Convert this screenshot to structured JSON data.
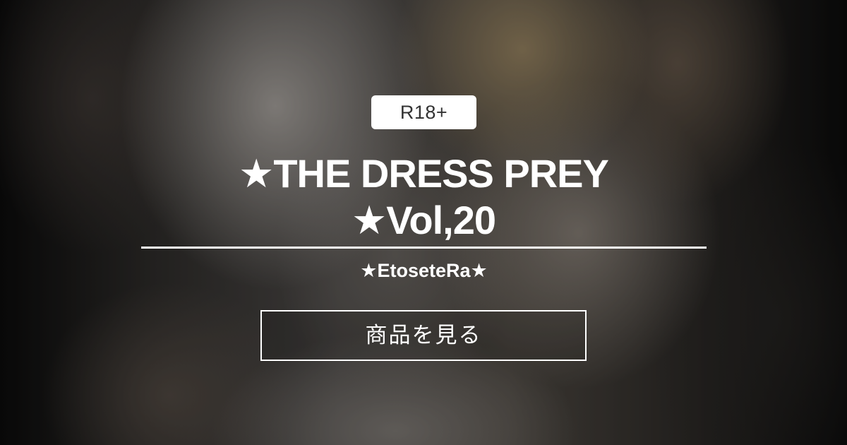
{
  "badge": {
    "rating": "R18+"
  },
  "product": {
    "title_line1": "★THE DRESS PREY",
    "title_line2": "★Vol,20",
    "creator": "★EtoseteRa★"
  },
  "actions": {
    "view_product_label": "商品を見る"
  },
  "colors": {
    "badge_background": "#ffffff",
    "badge_text": "#333333",
    "text": "#ffffff",
    "button_border": "#ffffff"
  }
}
